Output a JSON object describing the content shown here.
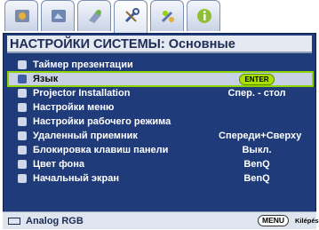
{
  "tabs": [
    {
      "icon": "image-settings-icon"
    },
    {
      "icon": "picture-adjust-icon"
    },
    {
      "icon": "source-icon"
    },
    {
      "icon": "system-settings-icon"
    },
    {
      "icon": "advanced-settings-icon"
    },
    {
      "icon": "information-icon"
    }
  ],
  "active_tab": 3,
  "panel": {
    "title": "НАСТРОЙКИ СИСТЕМЫ: Основные"
  },
  "items": [
    {
      "label": "Таймер презентации",
      "value": "",
      "icon": "timer-icon"
    },
    {
      "label": "Язык",
      "value": "ENTER",
      "icon": "language-icon",
      "selected": true
    },
    {
      "label": "Projector Installation",
      "value": "Спер. - стол",
      "icon": "projector-icon"
    },
    {
      "label": "Настройки меню",
      "value": "",
      "icon": "menu-settings-icon"
    },
    {
      "label": "Настройки рабочего режима",
      "value": "",
      "icon": "operation-mode-icon"
    },
    {
      "label": "Удаленный приемник",
      "value": "Спереди+Сверху",
      "icon": "remote-receiver-icon"
    },
    {
      "label": "Блокировка клавиш панели",
      "value": "Выкл.",
      "icon": "panel-key-lock-icon"
    },
    {
      "label": "Цвет фона",
      "value": "BenQ",
      "icon": "background-color-icon"
    },
    {
      "label": "Начальный экран",
      "value": "BenQ",
      "icon": "splash-screen-icon"
    }
  ],
  "footer": {
    "source": "Analog RGB",
    "menu_key": "MENU",
    "exit_label": "Kilépés"
  },
  "colors": {
    "panel": "#1f3b7a",
    "highlight": "#8fd400",
    "title_bg": "#e4e9f2"
  }
}
